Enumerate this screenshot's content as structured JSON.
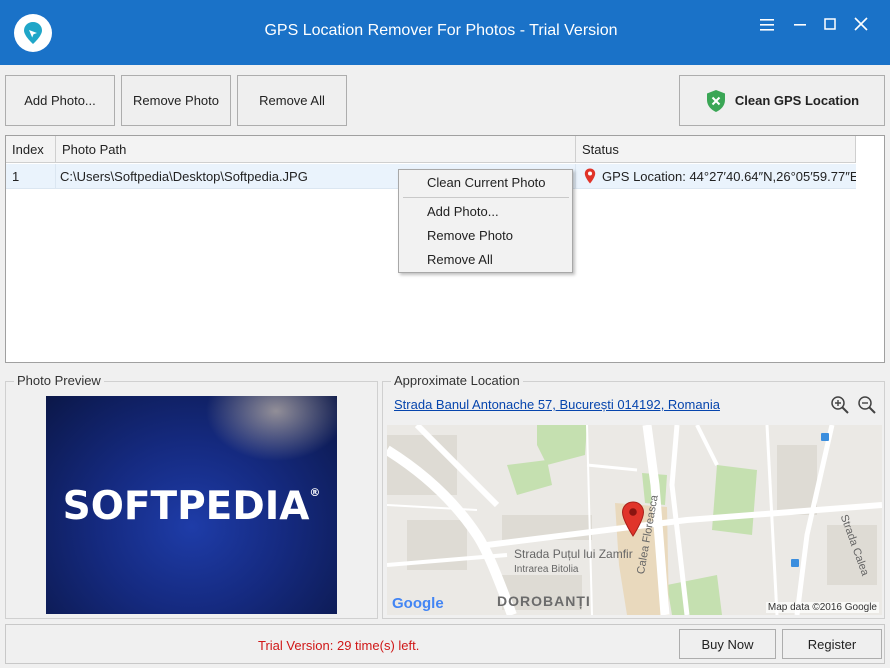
{
  "window": {
    "title": "GPS Location Remover For Photos - Trial Version",
    "logo_icon": "map-pin-icon",
    "controls": [
      "menu-icon",
      "minimize-icon",
      "maximize-icon",
      "close-icon"
    ],
    "accent_color": "#1a72c8"
  },
  "toolbar": {
    "add_photo": "Add Photo...",
    "remove_photo": "Remove Photo",
    "remove_all": "Remove All",
    "clean_gps": "Clean GPS Location",
    "clean_icon": "shield-check-icon"
  },
  "table": {
    "columns": [
      "Index",
      "Photo Path",
      "Status"
    ],
    "rows": [
      {
        "index": "1",
        "path": "C:\\Users\\Softpedia\\Desktop\\Softpedia.JPG",
        "status": "GPS Location: 44°27′40.64″N,26°05′59.77″E"
      }
    ]
  },
  "context_menu": {
    "items": [
      "Clean Current Photo",
      "Add Photo...",
      "Remove Photo",
      "Remove All"
    ]
  },
  "preview": {
    "label": "Photo Preview",
    "image_text": "SOFTPEDIA",
    "image_mark": "®"
  },
  "location": {
    "label": "Approximate Location",
    "address": "Strada Banul Antonache 57, București 014192, Romania",
    "zoom_in_icon": "zoom-in-icon",
    "zoom_out_icon": "zoom-out-icon",
    "map": {
      "street_1": "Strada Puțul lui Zamfir",
      "street_2": "Intrarea Bitolia",
      "street_3": "Calea Floreasca",
      "street_4": "Strada Calea",
      "district": "DOROBANȚI",
      "brand": "Google",
      "credit": "Map data ©2016 Google",
      "marker_color": "#e0342a"
    }
  },
  "footer": {
    "trial": "Trial Version: 29 time(s) left.",
    "buy_now": "Buy Now",
    "register": "Register",
    "trial_color": "#d01818"
  }
}
